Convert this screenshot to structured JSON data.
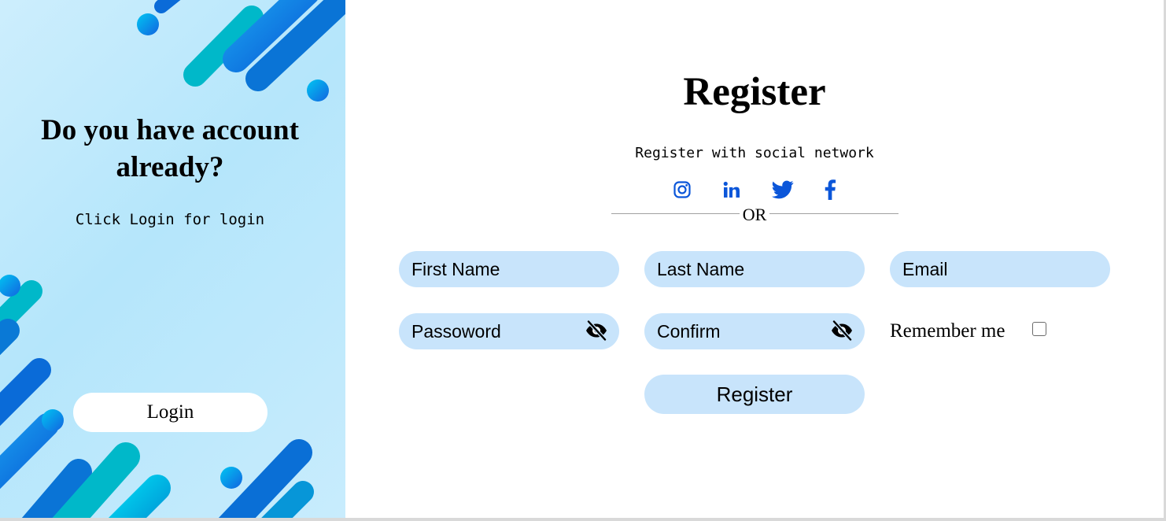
{
  "left_panel": {
    "heading_line1": "Do you have account",
    "heading_line2": "already?",
    "subtitle": "Click Login for login",
    "login_button": "Login"
  },
  "register": {
    "title": "Register",
    "social_text": "Register with social network",
    "social_icons": [
      "instagram-icon",
      "linkedin-icon",
      "twitter-icon",
      "facebook-icon"
    ],
    "divider_text": "OR",
    "fields": {
      "first_name": "First Name",
      "last_name": "Last Name",
      "email": "Email",
      "password": "Passoword",
      "confirm": "Confirm"
    },
    "remember_label": "Remember me",
    "remember_checked": false,
    "submit_button": "Register"
  },
  "colors": {
    "accent": "#0b56d9",
    "field_bg": "#c8e4fb",
    "panel_bg": "#b5e6fb"
  }
}
